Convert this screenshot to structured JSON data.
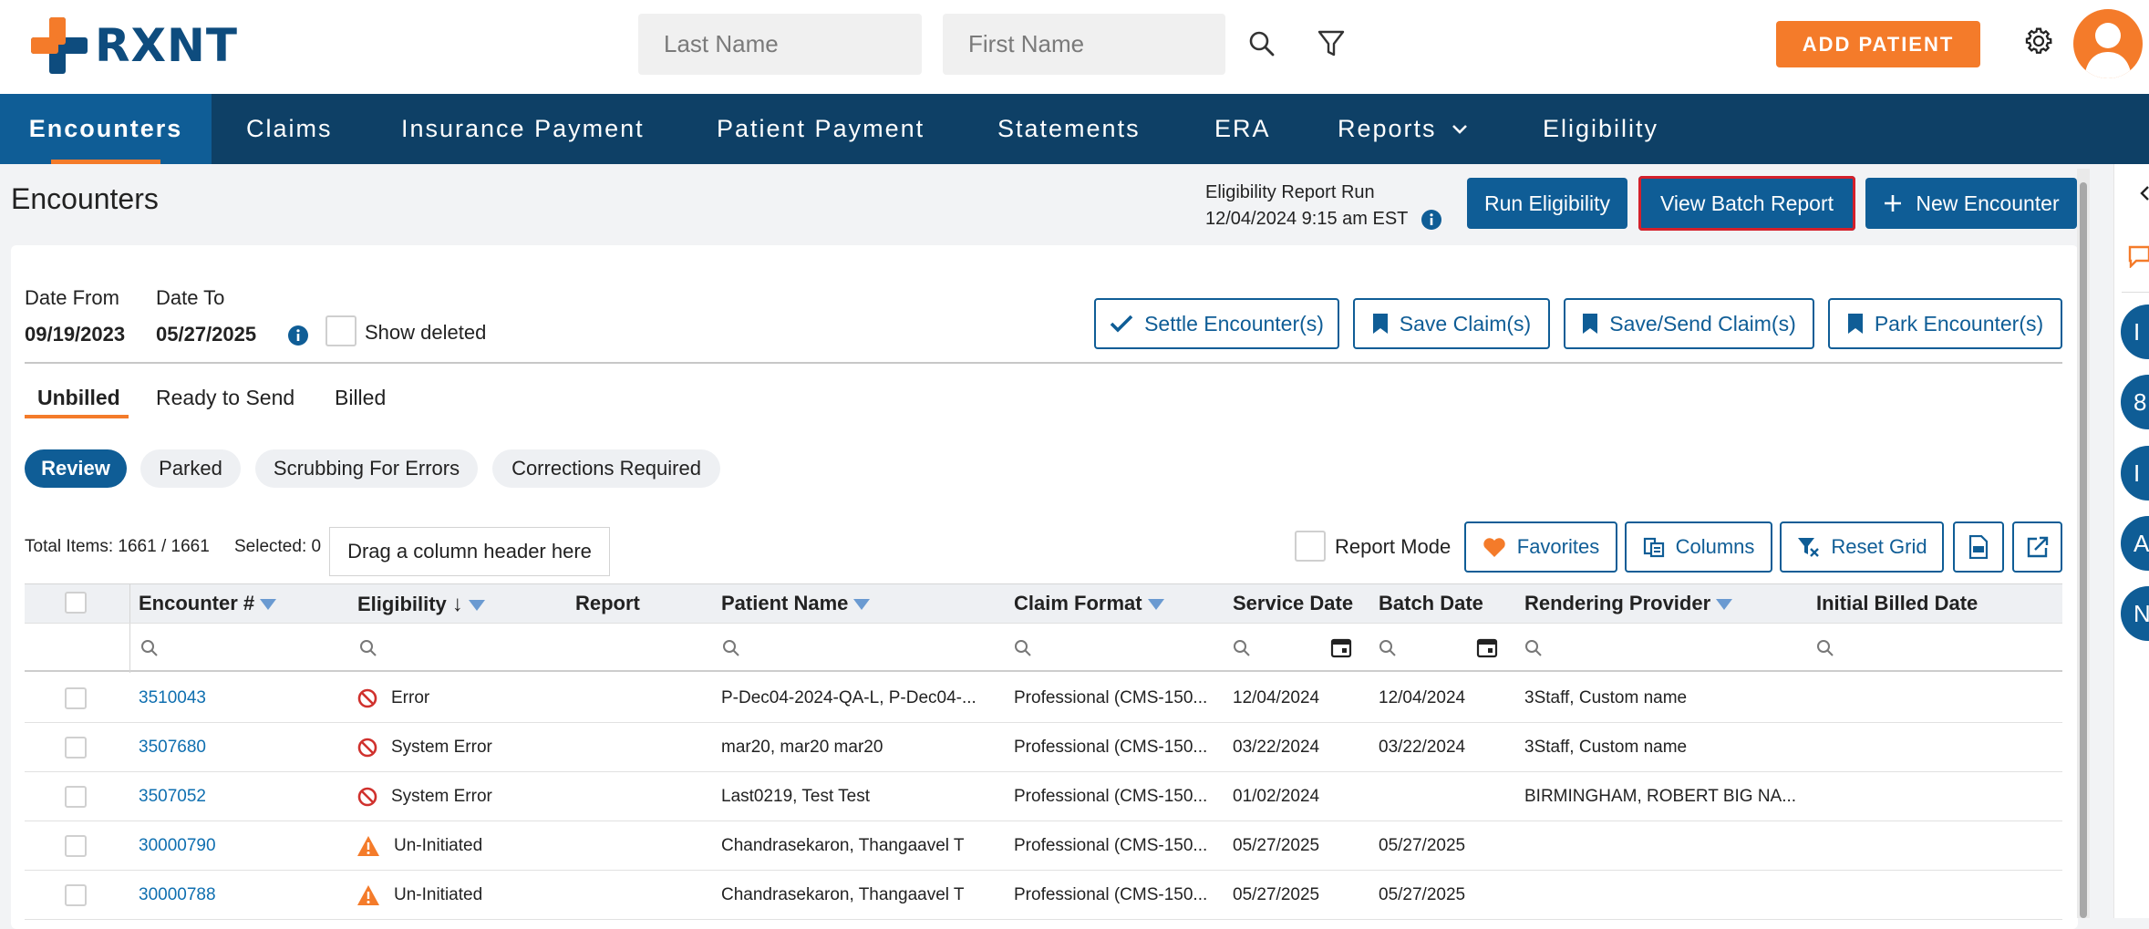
{
  "brand": {
    "name": "RXNT"
  },
  "search": {
    "last_name_placeholder": "Last Name",
    "first_name_placeholder": "First Name"
  },
  "header": {
    "add_patient_label": "ADD PATIENT"
  },
  "nav": {
    "items": [
      {
        "label": "Encounters",
        "active": true
      },
      {
        "label": "Claims"
      },
      {
        "label": "Insurance Payment"
      },
      {
        "label": "Patient Payment"
      },
      {
        "label": "Statements"
      },
      {
        "label": "ERA"
      },
      {
        "label": "Reports"
      },
      {
        "label": "Eligibility"
      }
    ]
  },
  "page": {
    "title": "Encounters",
    "eligibility_run_label": "Eligibility Report Run",
    "eligibility_run_time": "12/04/2024 9:15 am EST",
    "run_eligibility_label": "Run Eligibility",
    "view_batch_report_label": "View Batch Report",
    "new_encounter_label": "New Encounter"
  },
  "filters": {
    "date_from_label": "Date From",
    "date_from_value": "09/19/2023",
    "date_to_label": "Date To",
    "date_to_value": "05/27/2025",
    "show_deleted_label": "Show deleted"
  },
  "actions": {
    "settle_label": "Settle Encounter(s)",
    "save_claim_label": "Save Claim(s)",
    "save_send_label": "Save/Send Claim(s)",
    "park_label": "Park Encounter(s)"
  },
  "tabs": [
    "Unbilled",
    "Ready to Send",
    "Billed"
  ],
  "pills": [
    "Review",
    "Parked",
    "Scrubbing For Errors",
    "Corrections Required"
  ],
  "grid_toolbar": {
    "total_items": "Total Items: 1661 / 1661",
    "selected": "Selected: 0",
    "drag_hint": "Drag a column header here",
    "report_mode_label": "Report Mode",
    "favorites_label": "Favorites",
    "columns_label": "Columns",
    "reset_grid_label": "Reset Grid"
  },
  "grid": {
    "columns": [
      "Encounter #",
      "Eligibility",
      "Report",
      "Patient Name",
      "Claim Format",
      "Service Date",
      "Batch Date",
      "Rendering Provider",
      "Initial Billed Date"
    ],
    "rows": [
      {
        "encounter": "3510043",
        "eligibility": "Error",
        "status": "error",
        "patient": "P-Dec04-2024-QA-L, P-Dec04-...",
        "format": "Professional (CMS-150...",
        "service_date": "12/04/2024",
        "batch_date": "12/04/2024",
        "provider": "3Staff, Custom name",
        "billed": ""
      },
      {
        "encounter": "3507680",
        "eligibility": "System Error",
        "status": "error",
        "patient": "mar20, mar20 mar20",
        "format": "Professional (CMS-150...",
        "service_date": "03/22/2024",
        "batch_date": "03/22/2024",
        "provider": "3Staff, Custom name",
        "billed": ""
      },
      {
        "encounter": "3507052",
        "eligibility": "System Error",
        "status": "error",
        "patient": "Last0219, Test Test",
        "format": "Professional (CMS-150...",
        "service_date": "01/02/2024",
        "batch_date": "",
        "provider": "BIRMINGHAM, ROBERT BIG NA...",
        "billed": ""
      },
      {
        "encounter": "30000790",
        "eligibility": "Un-Initiated",
        "status": "warning",
        "patient": "Chandrasekaron, Thangaavel T",
        "format": "Professional (CMS-150...",
        "service_date": "05/27/2025",
        "batch_date": "05/27/2025",
        "provider": "",
        "billed": ""
      },
      {
        "encounter": "30000788",
        "eligibility": "Un-Initiated",
        "status": "warning",
        "patient": "Chandrasekaron, Thangaavel T",
        "format": "Professional (CMS-150...",
        "service_date": "05/27/2025",
        "batch_date": "05/27/2025",
        "provider": "",
        "billed": ""
      }
    ]
  },
  "rail": {
    "items": [
      "I",
      "8",
      "I",
      "A",
      "N"
    ]
  },
  "colors": {
    "primary": "#0f5d96",
    "nav": "#0e4066",
    "accent": "#f47b2a",
    "error": "#d0312d",
    "warning": "#f47b2a"
  }
}
